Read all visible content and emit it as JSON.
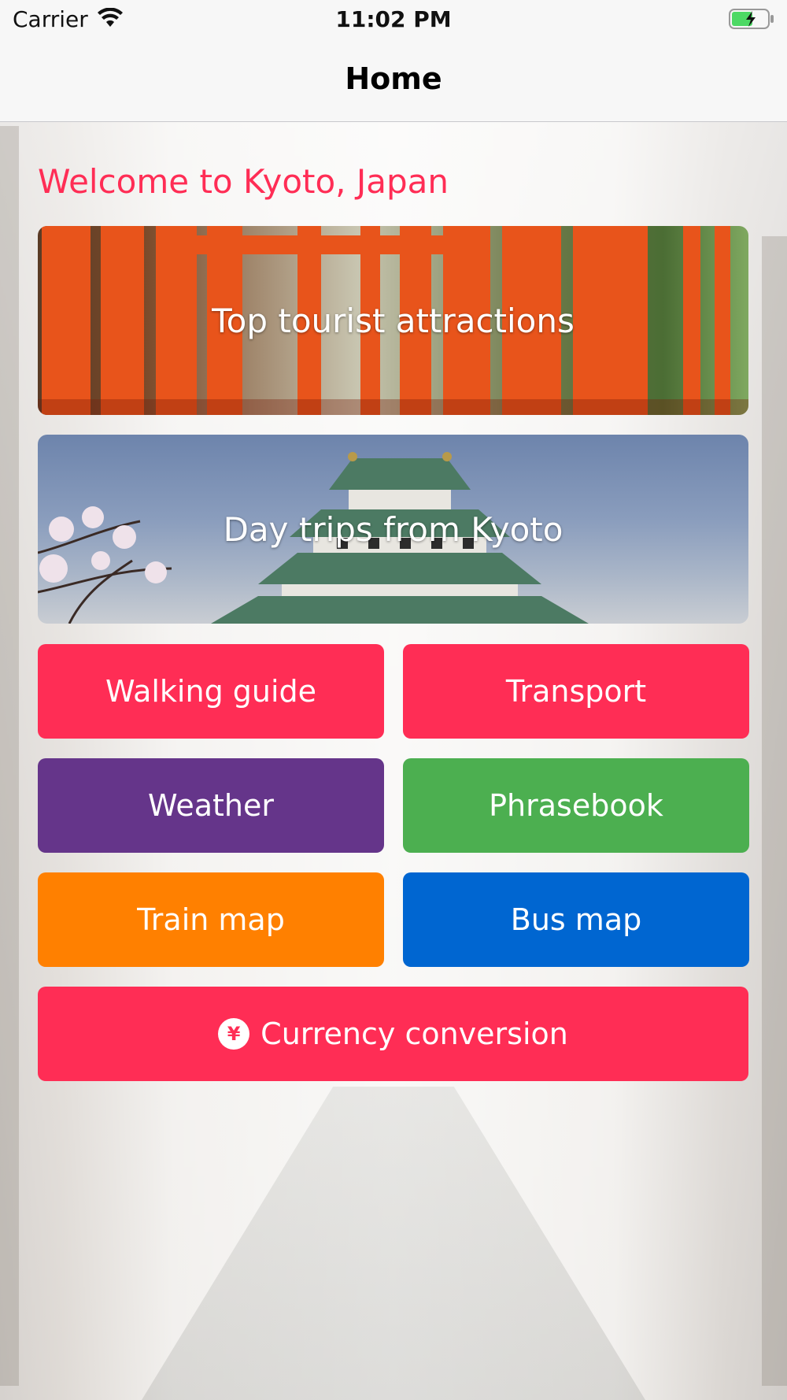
{
  "status_bar": {
    "carrier": "Carrier",
    "time": "11:02 PM"
  },
  "nav": {
    "title": "Home"
  },
  "welcome": "Welcome to Kyoto, Japan",
  "banners": [
    {
      "label": "Top tourist attractions"
    },
    {
      "label": "Day trips from Kyoto"
    }
  ],
  "tiles": [
    {
      "label": "Walking guide",
      "color": "#ff2d55"
    },
    {
      "label": "Transport",
      "color": "#ff2d55"
    },
    {
      "label": "Weather",
      "color": "#65358a"
    },
    {
      "label": "Phrasebook",
      "color": "#4caf50"
    },
    {
      "label": "Train map",
      "color": "#ff8000"
    },
    {
      "label": "Bus map",
      "color": "#0066d1"
    }
  ],
  "currency": {
    "label": "Currency conversion",
    "icon": "yen-icon",
    "symbol": "¥",
    "color": "#ff2d55"
  }
}
